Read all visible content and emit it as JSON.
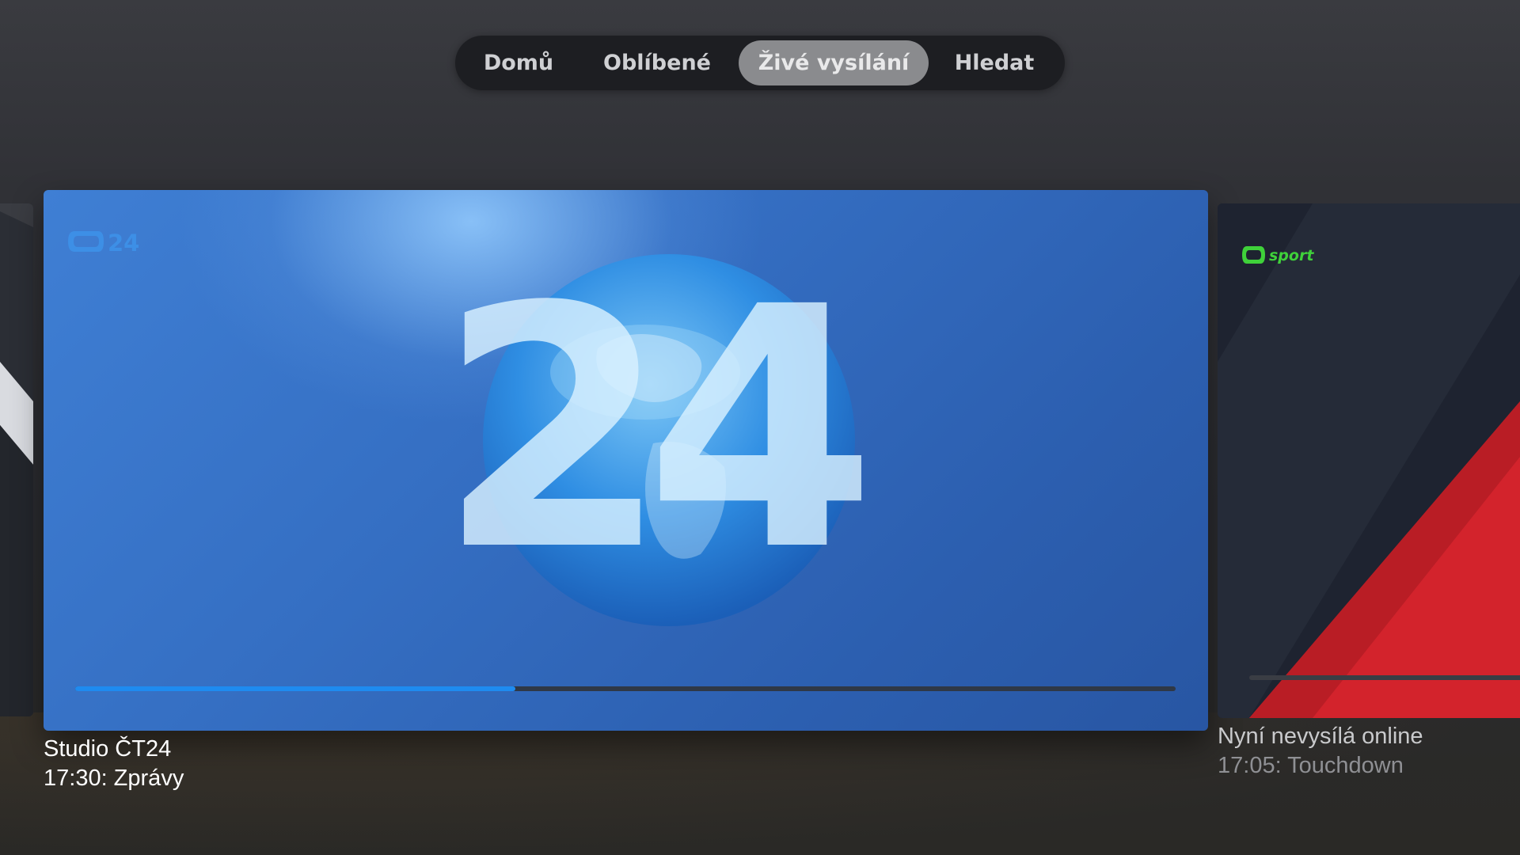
{
  "tabs": [
    {
      "label": "Domů",
      "selected": false
    },
    {
      "label": "Oblíbené",
      "selected": false
    },
    {
      "label": "Živé vysílání",
      "selected": true
    },
    {
      "label": "Hledat",
      "selected": false
    }
  ],
  "main_card": {
    "channel_logo_text": "24",
    "artwork_text": "24",
    "progress": 0.4,
    "title": "Studio ČT24",
    "subtitle": "17:30: Zprávy"
  },
  "right_card": {
    "channel_logo_text": "sport",
    "title": "Nyní nevysílá online",
    "subtitle": "17:05: Touchdown"
  },
  "colors": {
    "accent": "#1e8bf0",
    "sport_green": "#3fd13a",
    "sport_red": "#d3232c",
    "tab_selected_bg": "#8a8b8e"
  },
  "icons": {
    "ct24_logo": "ct24-logo-icon",
    "ctsport_logo": "ct-sport-logo-icon"
  }
}
